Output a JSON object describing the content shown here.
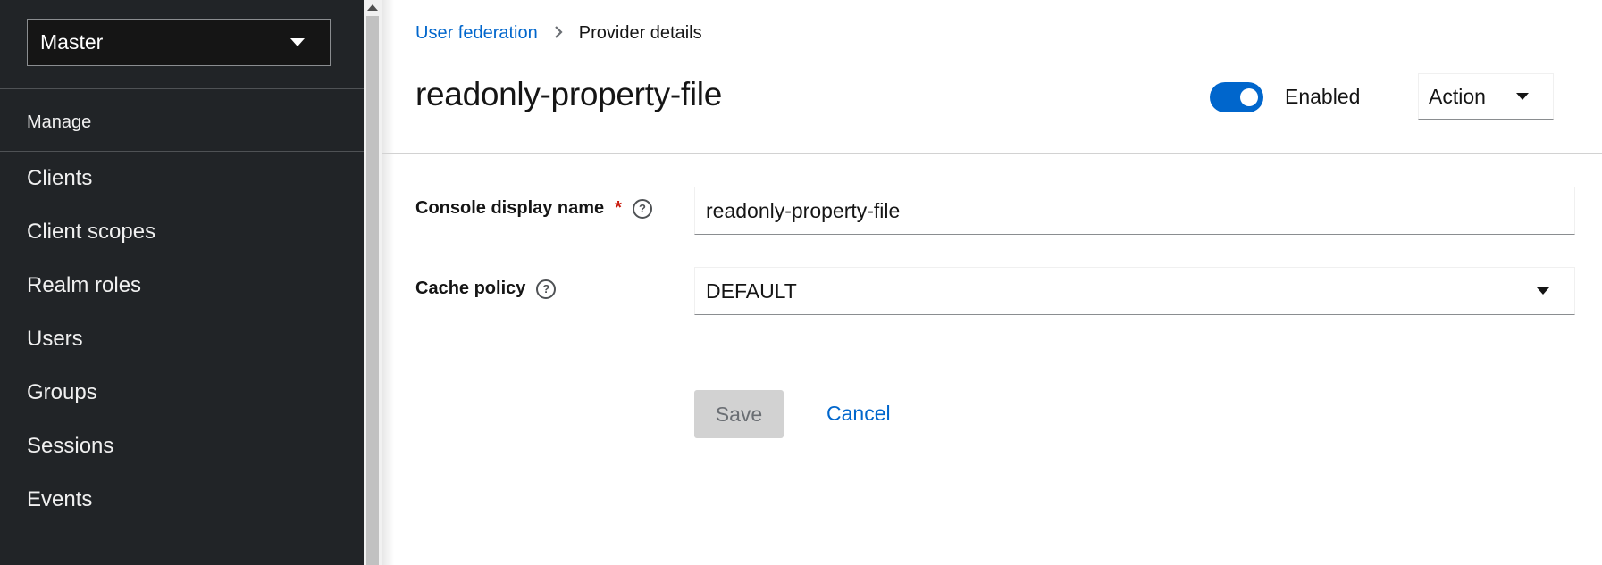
{
  "sidebar": {
    "realm_selector": {
      "value": "Master"
    },
    "section_title": "Manage",
    "items": [
      {
        "label": "Clients"
      },
      {
        "label": "Client scopes"
      },
      {
        "label": "Realm roles"
      },
      {
        "label": "Users"
      },
      {
        "label": "Groups"
      },
      {
        "label": "Sessions"
      },
      {
        "label": "Events"
      }
    ]
  },
  "breadcrumb": {
    "parent": "User federation",
    "separator_icon": "chevron-right-icon",
    "current": "Provider details"
  },
  "header": {
    "title": "readonly-property-file",
    "enabled_label": "Enabled",
    "enabled": true,
    "action_label": "Action"
  },
  "form": {
    "display_name": {
      "label": "Console display name",
      "required_marker": "*",
      "value": "readonly-property-file"
    },
    "cache_policy": {
      "label": "Cache policy",
      "value": "DEFAULT"
    },
    "help_icon_glyph": "?",
    "save_label": "Save",
    "cancel_label": "Cancel"
  },
  "colors": {
    "sidebar_bg": "#212427",
    "accent": "#0066cc",
    "required": "#c9190b",
    "disabled_button_bg": "#d2d2d2"
  }
}
